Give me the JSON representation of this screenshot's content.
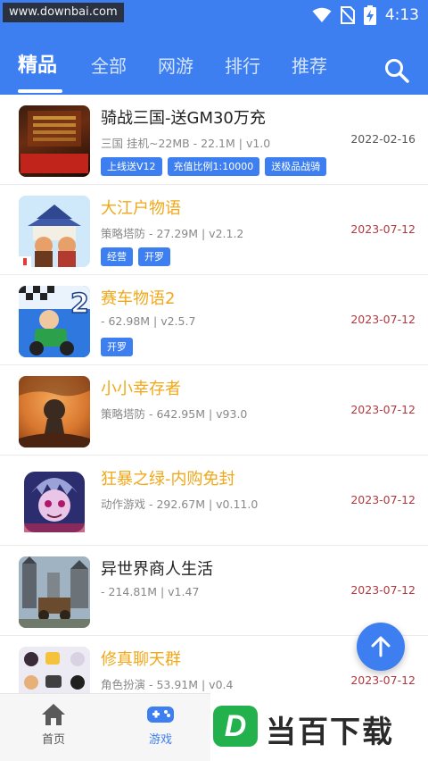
{
  "watermark": "www.downbai.com",
  "status": {
    "time": "4:13"
  },
  "tabs": [
    {
      "label": "精品"
    },
    {
      "label": "全部"
    },
    {
      "label": "网游"
    },
    {
      "label": "排行"
    },
    {
      "label": "推荐"
    }
  ],
  "active_tab": "精品",
  "games": [
    {
      "title": "骑战三国-送GM30万充",
      "meta": "三国 挂机~22MB - 22.1M | v1.0",
      "date": "2022-02-16",
      "tags": [
        "上线送V12",
        "充值比例1:10000",
        "送极品战骑"
      ],
      "thumb_text": "至尊 充"
    },
    {
      "title": "大江户物语",
      "meta": "策略塔防 - 27.29M | v2.1.2",
      "date": "2023-07-12",
      "tags": [
        "经营",
        "开罗"
      ]
    },
    {
      "title": "赛车物语2",
      "meta": " - 62.98M | v2.5.7",
      "date": "2023-07-12",
      "tags": [
        "开罗"
      ]
    },
    {
      "title": "小小幸存者",
      "meta": "策略塔防 - 642.95M | v93.0",
      "date": "2023-07-12",
      "tags": []
    },
    {
      "title": "狂暴之绿-内购免封",
      "meta": "动作游戏 - 292.67M | v0.11.0",
      "date": "2023-07-12",
      "tags": []
    },
    {
      "title": "异世界商人生活",
      "meta": " - 214.81M | v1.47",
      "date": "2023-07-12",
      "tags": []
    },
    {
      "title": "修真聊天群",
      "meta": "角色扮演 - 53.91M | v0.4",
      "date": "2023-07-12",
      "tags": []
    }
  ],
  "bottom_nav": [
    {
      "label": "首页",
      "icon": "home-icon"
    },
    {
      "label": "游戏",
      "icon": "gamepad-icon"
    }
  ],
  "brand": {
    "letter": "D",
    "text": "当百下载"
  },
  "colors": {
    "primary": "#3d7ff0",
    "gold_title": "#f0a81a",
    "date_red": "#b0383f"
  }
}
